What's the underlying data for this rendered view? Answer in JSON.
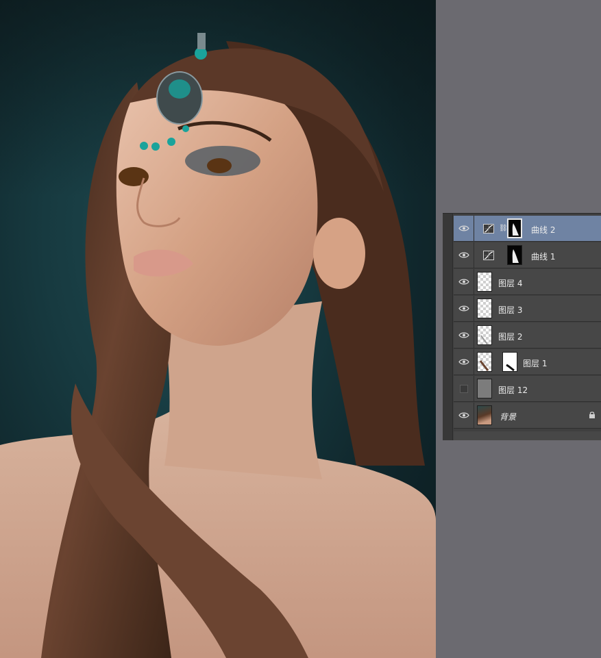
{
  "layers_panel": {
    "layers": [
      {
        "name": "曲线 2",
        "kind": "adjustment",
        "visible": true,
        "selected": true,
        "has_mask": true,
        "linked": true
      },
      {
        "name": "曲线 1",
        "kind": "adjustment",
        "visible": true,
        "selected": false,
        "has_mask": true,
        "linked": false
      },
      {
        "name": "图层 4",
        "kind": "pixel",
        "visible": true,
        "selected": false,
        "has_mask": false
      },
      {
        "name": "图层 3",
        "kind": "pixel",
        "visible": true,
        "selected": false,
        "has_mask": false
      },
      {
        "name": "图层 2",
        "kind": "pixel",
        "visible": true,
        "selected": false,
        "has_mask": false
      },
      {
        "name": "图层 1",
        "kind": "pixel",
        "visible": true,
        "selected": false,
        "has_mask": true
      },
      {
        "name": "图层 12",
        "kind": "fill",
        "visible": false,
        "selected": false,
        "has_mask": false
      },
      {
        "name": "背景",
        "kind": "background",
        "visible": true,
        "selected": false,
        "locked": true
      }
    ]
  },
  "colors": {
    "workspace_bg": "#6b6a70",
    "panel_bg": "#474747",
    "selected_row": "#6f83a3",
    "photo_backdrop": "#173a40"
  }
}
